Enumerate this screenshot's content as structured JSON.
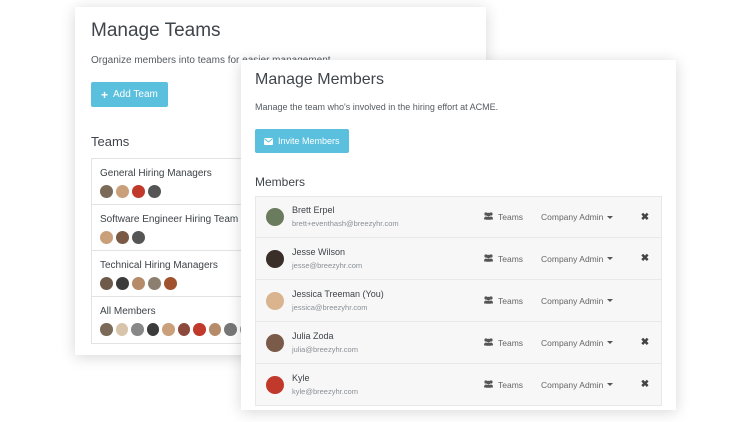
{
  "teams_panel": {
    "title": "Manage Teams",
    "description": "Organize members into teams for easier management.",
    "add_button_label": "Add Team",
    "section_heading": "Teams",
    "teams": [
      {
        "name": "General Hiring Managers",
        "avatar_colors": [
          "#7b6a58",
          "#c9a07a",
          "#c0392b",
          "#555555"
        ]
      },
      {
        "name": "Software Engineer Hiring Team",
        "avatar_colors": [
          "#c9a07a",
          "#7b5a45",
          "#555555"
        ]
      },
      {
        "name": "Technical Hiring Managers",
        "avatar_colors": [
          "#6d5a4a",
          "#3b3b3b",
          "#b58b6a",
          "#8d7f70",
          "#a0522d"
        ]
      },
      {
        "name": "All Members",
        "avatar_colors": [
          "#7b6a58",
          "#d8c4aa",
          "#888888",
          "#3b3b3b",
          "#c9a07a",
          "#8b4a3c",
          "#c0392b",
          "#b58b6a",
          "#777777",
          "#999999"
        ]
      }
    ]
  },
  "members_panel": {
    "title": "Manage Members",
    "description": "Manage the team who's involved in the hiring effort at ACME.",
    "invite_button_label": "Invite Members",
    "section_heading": "Members",
    "teams_label": "Teams",
    "members": [
      {
        "name": "Brett Erpel",
        "email": "brett+eventhash@breezyhr.com",
        "role": "Company Admin",
        "removable": true,
        "avatar_color": "#6b7b5e"
      },
      {
        "name": "Jesse Wilson",
        "email": "jesse@breezyhr.com",
        "role": "Company Admin",
        "removable": true,
        "avatar_color": "#3a2e28"
      },
      {
        "name": "Jessica Treeman (You)",
        "email": "jessica@breezyhr.com",
        "role": "Company Admin",
        "removable": false,
        "avatar_color": "#d9b48f"
      },
      {
        "name": "Julia Zoda",
        "email": "julia@breezyhr.com",
        "role": "Company Admin",
        "removable": true,
        "avatar_color": "#7a5a48"
      },
      {
        "name": "Kyle",
        "email": "kyle@breezyhr.com",
        "role": "Company Admin",
        "removable": true,
        "avatar_color": "#c0392b"
      }
    ]
  },
  "icons": {
    "plus": "plus-icon",
    "envelope": "envelope-icon",
    "users": "users-icon",
    "remove": "times-icon"
  },
  "colors": {
    "primary_button": "#5bc0de",
    "row_background": "#f7f7f7"
  }
}
